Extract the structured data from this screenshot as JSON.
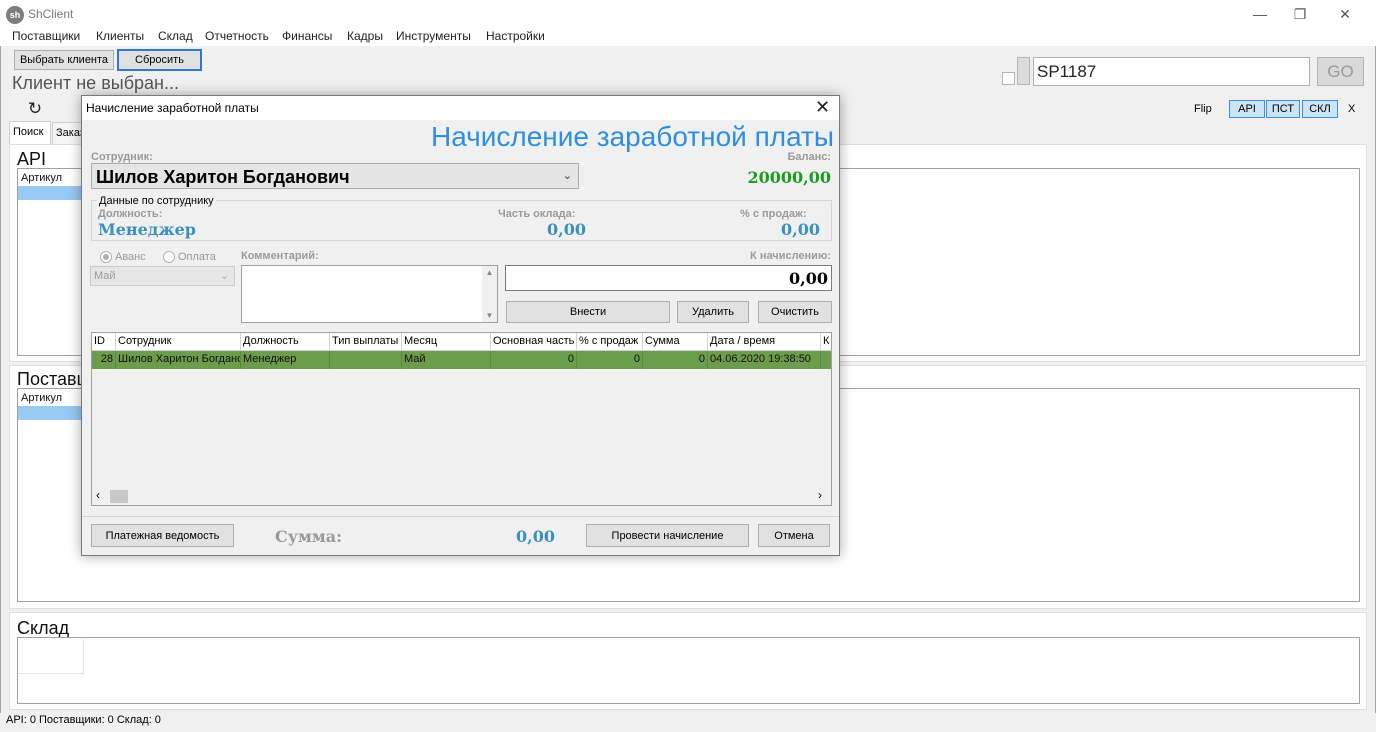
{
  "app": {
    "title": "ShClient",
    "logo": "sh"
  },
  "window_controls": {
    "minimize": "—",
    "restore": "❐",
    "close": "✕"
  },
  "menu": [
    "Поставщики",
    "Клиенты",
    "Склад",
    "Отчетность",
    "Финансы",
    "Кадры",
    "Инструменты",
    "Настройки"
  ],
  "toolbar": {
    "select_client_label": "Выбрать клиента",
    "reset_label": "Сбросить",
    "client_status": "Клиент не выбран...",
    "code_value": "SP1187",
    "go_label": "GO"
  },
  "subbar": {
    "flip_label": "Flip",
    "sources": [
      "API",
      "ПСТ",
      "СКЛ"
    ],
    "close_label": "X"
  },
  "tabs": [
    "Поиск",
    "Заказ"
  ],
  "sections": {
    "api": {
      "title": "API",
      "column": "Артикул"
    },
    "suppliers": {
      "title": "Поставщики",
      "column": "Артикул"
    },
    "warehouse": {
      "title": "Склад"
    }
  },
  "statusbar": {
    "text": "API: 0  Поставщики: 0  Склад: 0"
  },
  "dialog": {
    "title": "Начисление заработной платы",
    "heading": "Начисление заработной платы",
    "employee_label": "Сотрудник:",
    "employee_value": "Шилов Харитон Богданович",
    "balance_label": "Баланс:",
    "balance_value": "20000,00",
    "group_label": "Данные по сотруднику",
    "position_label": "Должность:",
    "position_value": "Менеджер",
    "salary_part_label": "Часть оклада:",
    "salary_part_value": "0,00",
    "sales_pct_label": "% с продаж:",
    "sales_pct_value": "0,00",
    "radio_advance": "Аванс",
    "radio_payment": "Оплата",
    "month_value": "Май",
    "comment_label": "Комментарий:",
    "accrual_label": "К начислению:",
    "accrual_value": "0,00",
    "add_label": "Внести",
    "delete_label": "Удалить",
    "clear_label": "Очистить",
    "grid": {
      "headers": [
        "ID",
        "Сотрудник",
        "Должность",
        "Тип выплаты",
        "Месяц",
        "Основная часть",
        "% с продаж",
        "Сумма",
        "Дата / время",
        "К"
      ],
      "rows": [
        [
          "28",
          "Шилов Харитон Богдано",
          "Менеджер",
          "",
          "Май",
          "0",
          "0",
          "0",
          "04.06.2020 19:38:50",
          ""
        ]
      ]
    },
    "payroll_label": "Платежная ведомость",
    "sum_label": "Сумма:",
    "sum_value": "0,00",
    "post_label": "Провести начисление",
    "cancel_label": "Отмена"
  }
}
